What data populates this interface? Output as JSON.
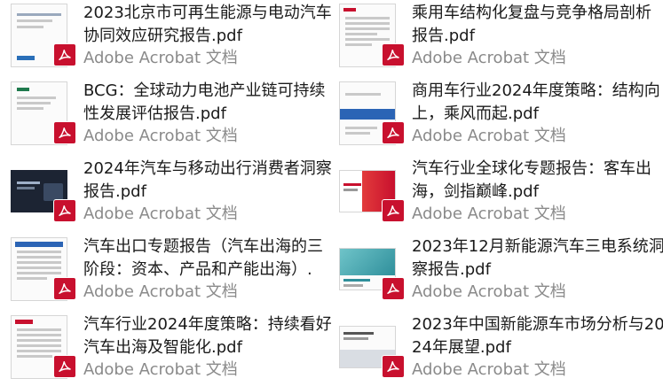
{
  "files": [
    {
      "title": "2023北京市可再生能源与电动汽车协同效应研究报告.pdf",
      "app": "Adobe Acrobat 文档",
      "thumb": "report-white"
    },
    {
      "title": "乘用车结构化复盘与竞争格局剖析报告.pdf",
      "app": "Adobe Acrobat 文档",
      "thumb": "report-red-header"
    },
    {
      "title": "BCG：全球动力电池产业链可持续性发展评估报告.pdf",
      "app": "Adobe Acrobat 文档",
      "thumb": "report-bcg"
    },
    {
      "title": "商用车行业2024年度策略：结构向上，乘风而起.pdf",
      "app": "Adobe Acrobat 文档",
      "thumb": "report-blue-band"
    },
    {
      "title": "2024年汽车与移动出行消费者洞察报告.pdf",
      "app": "Adobe Acrobat 文档",
      "thumb": "report-dark"
    },
    {
      "title": "汽车行业全球化专题报告：客车出海，剑指巅峰.pdf",
      "app": "Adobe Acrobat 文档",
      "thumb": "report-red-cover"
    },
    {
      "title": "汽车出口专题报告（汽车出海的三阶段：资本、产品和产能出海）.p...",
      "app": "Adobe Acrobat 文档",
      "thumb": "report-text-blue"
    },
    {
      "title": "2023年12月新能源汽车三电系统洞察报告.pdf",
      "app": "Adobe Acrobat 文档",
      "thumb": "report-teal"
    },
    {
      "title": "汽车行业2024年度策略：持续看好汽车出海及智能化.pdf",
      "app": "Adobe Acrobat 文档",
      "thumb": "report-red-text"
    },
    {
      "title": "2023年中国新能源车市场分析与2024年展望.pdf",
      "app": "Adobe Acrobat 文档",
      "thumb": "report-gray"
    }
  ],
  "colors": {
    "title": "#1a1a1a",
    "app": "#8a8a8a",
    "pdf_badge": "#c8102e"
  },
  "icons": {
    "badge": "acrobat-pdf-icon"
  }
}
